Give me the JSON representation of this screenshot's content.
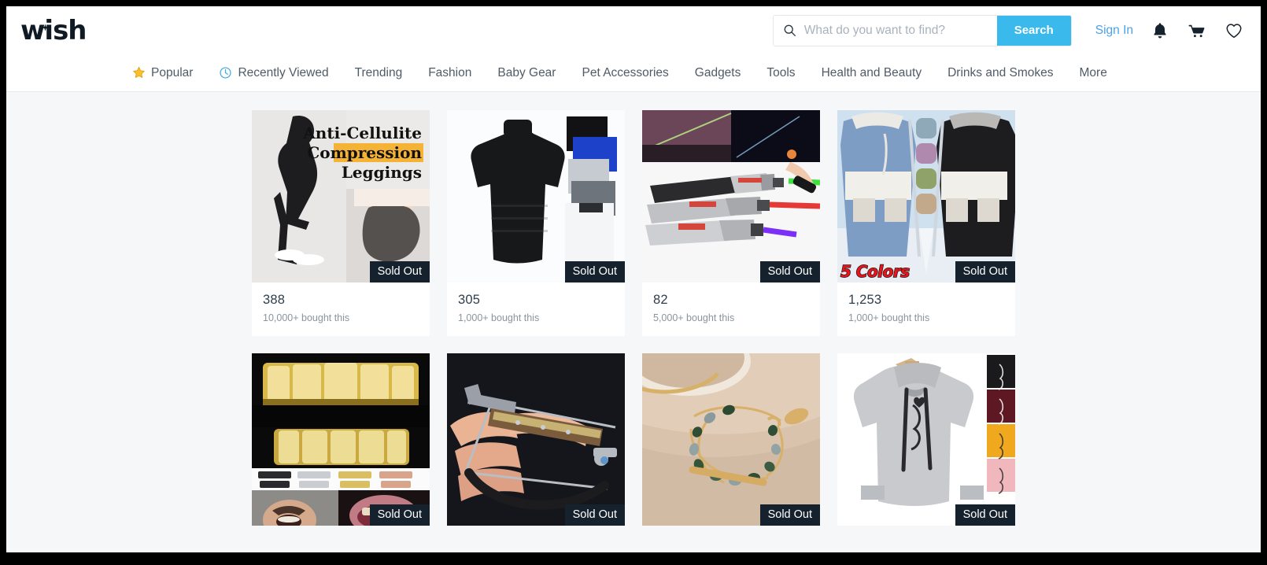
{
  "header": {
    "logo_text": "wish",
    "search": {
      "placeholder": "What do you want to find?",
      "value": "",
      "button_label": "Search"
    },
    "sign_in_label": "Sign In",
    "icons": [
      "bell-icon",
      "cart-icon",
      "heart-icon"
    ],
    "accent_color": "#39b9ec",
    "link_color": "#4aa3e8"
  },
  "nav": {
    "items": [
      {
        "label": "Popular",
        "icon": "star-icon"
      },
      {
        "label": "Recently Viewed",
        "icon": "clock-icon"
      },
      {
        "label": "Trending",
        "icon": ""
      },
      {
        "label": "Fashion",
        "icon": ""
      },
      {
        "label": "Baby Gear",
        "icon": ""
      },
      {
        "label": "Pet Accessories",
        "icon": ""
      },
      {
        "label": "Gadgets",
        "icon": ""
      },
      {
        "label": "Tools",
        "icon": ""
      },
      {
        "label": "Health and Beauty",
        "icon": ""
      },
      {
        "label": "Drinks and Smokes",
        "icon": ""
      },
      {
        "label": "More",
        "icon": ""
      }
    ]
  },
  "products": [
    {
      "price": "388",
      "bought": "10,000+ bought this",
      "badge": "Sold Out",
      "overlay": "",
      "art": "leggings",
      "image_text": [
        "Anti-Cellulite",
        "Compression",
        "Leggings"
      ]
    },
    {
      "price": "305",
      "bought": "1,000+ bought this",
      "badge": "Sold Out",
      "overlay": "",
      "art": "turtleneck",
      "image_text": []
    },
    {
      "price": "82",
      "bought": "5,000+ bought this",
      "badge": "Sold Out",
      "overlay": "",
      "art": "laser",
      "image_text": []
    },
    {
      "price": "1,253",
      "bought": "1,000+ bought this",
      "badge": "Sold Out",
      "overlay": "5 Colors",
      "art": "jacket",
      "image_text": []
    },
    {
      "price": "",
      "bought": "",
      "badge": "Sold Out",
      "overlay": "",
      "art": "grillz",
      "image_text": []
    },
    {
      "price": "",
      "bought": "",
      "badge": "Sold Out",
      "overlay": "",
      "art": "crossbow",
      "image_text": []
    },
    {
      "price": "",
      "bought": "",
      "badge": "Sold Out",
      "overlay": "",
      "art": "bracelet",
      "image_text": []
    },
    {
      "price": "",
      "bought": "",
      "badge": "Sold Out",
      "overlay": "",
      "art": "hoodie",
      "image_text": []
    }
  ]
}
